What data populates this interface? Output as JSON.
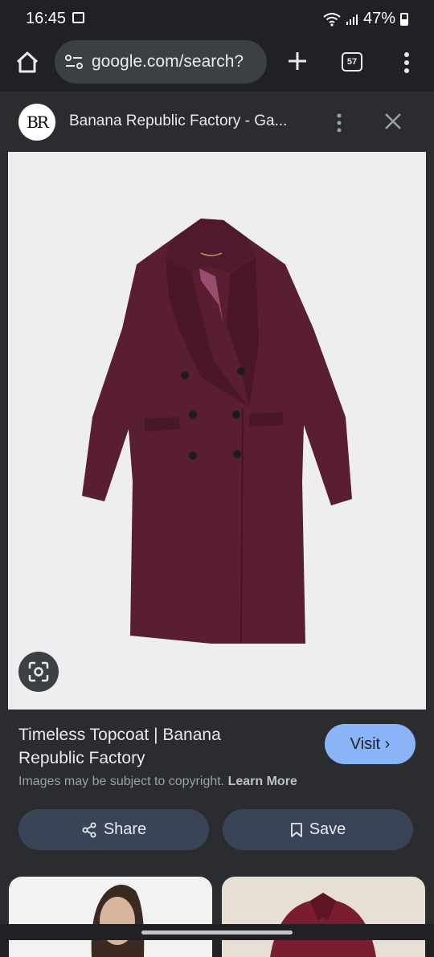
{
  "status": {
    "time": "16:45",
    "battery": "47%",
    "image_icon": "image-icon",
    "wifi_icon": "wifi-icon",
    "signal_icon": "signal-icon"
  },
  "browser": {
    "url": "google.com/search?",
    "tab_count": "57",
    "icons": [
      "home-icon",
      "site-settings-icon",
      "new-tab-icon",
      "more-vert-icon"
    ]
  },
  "sheet": {
    "logo_text": "BR",
    "site_title": "Banana Republic Factory - Ga...",
    "image_caption": "Timeless Topcoat | Banana Republic Factory",
    "visit_label": "Visit",
    "copyright_text": "Images may be subject to copyright.",
    "learn_more": "Learn More",
    "share_label": "Share",
    "save_label": "Save"
  },
  "colors": {
    "coat": "#5a1e33",
    "accent": "#8ab4f8",
    "button_bg": "#394457",
    "background": "#202124"
  }
}
